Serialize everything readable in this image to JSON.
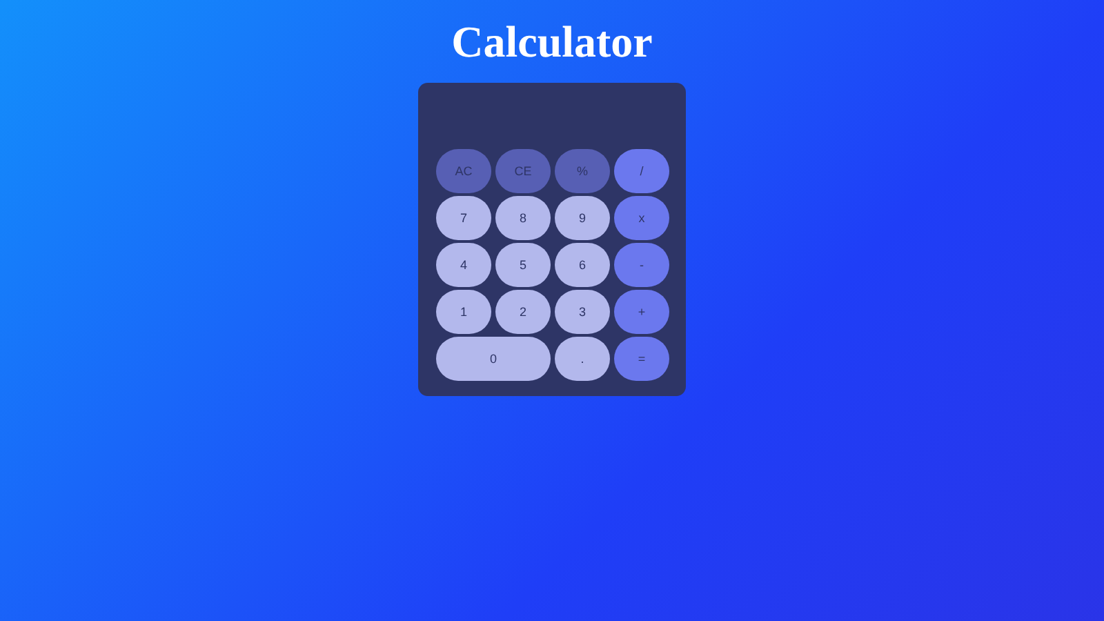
{
  "title": "Calculator",
  "keys": [
    {
      "label": "AC",
      "kind": "function",
      "wide": false
    },
    {
      "label": "CE",
      "kind": "function",
      "wide": false
    },
    {
      "label": "%",
      "kind": "function",
      "wide": false
    },
    {
      "label": "/",
      "kind": "operator",
      "wide": false
    },
    {
      "label": "7",
      "kind": "digit",
      "wide": false
    },
    {
      "label": "8",
      "kind": "digit",
      "wide": false
    },
    {
      "label": "9",
      "kind": "digit",
      "wide": false
    },
    {
      "label": "x",
      "kind": "operator",
      "wide": false
    },
    {
      "label": "4",
      "kind": "digit",
      "wide": false
    },
    {
      "label": "5",
      "kind": "digit",
      "wide": false
    },
    {
      "label": "6",
      "kind": "digit",
      "wide": false
    },
    {
      "label": "-",
      "kind": "operator",
      "wide": false
    },
    {
      "label": "1",
      "kind": "digit",
      "wide": false
    },
    {
      "label": "2",
      "kind": "digit",
      "wide": false
    },
    {
      "label": "3",
      "kind": "digit",
      "wide": false
    },
    {
      "label": "+",
      "kind": "operator",
      "wide": false
    },
    {
      "label": "0",
      "kind": "digit",
      "wide": true
    },
    {
      "label": ".",
      "kind": "digit",
      "wide": false
    },
    {
      "label": "=",
      "kind": "operator",
      "wide": false
    }
  ]
}
